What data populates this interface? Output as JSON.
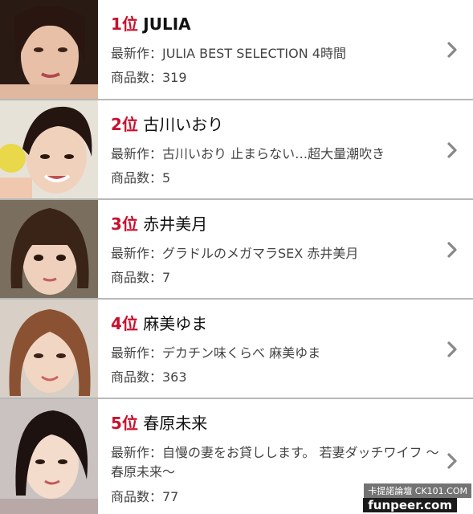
{
  "ranking": [
    {
      "rank": "1位",
      "name": "JULIA",
      "latest": "最新作：JULIA BEST SELECTION 4時間",
      "count": "商品数：319"
    },
    {
      "rank": "2位",
      "name": "古川いおり",
      "latest": "最新作：古川いおり 止まらない…超大量潮吹き",
      "count": "商品数：5"
    },
    {
      "rank": "3位",
      "name": "赤井美月",
      "latest": "最新作：グラドルのメガマラSEX 赤井美月",
      "count": "商品数：7"
    },
    {
      "rank": "4位",
      "name": "麻美ゆま",
      "latest": "最新作：デカチン味くらべ 麻美ゆま",
      "count": "商品数：363"
    },
    {
      "rank": "5位",
      "name": "春原未来",
      "latest": "最新作：自慢の妻をお貸しします。 若妻ダッチワイフ ～春原未来～",
      "count": "商品数：77"
    }
  ],
  "icons": {
    "row_arrow": "chevron-right-icon",
    "photo": "portrait-photo"
  },
  "colors": {
    "rank": "#c8102e",
    "divider": "#b8b8b8",
    "text": "#444444"
  },
  "watermark": {
    "line1": "卡提諾論壇 CK101.COM",
    "line2": "funpeer.com"
  }
}
